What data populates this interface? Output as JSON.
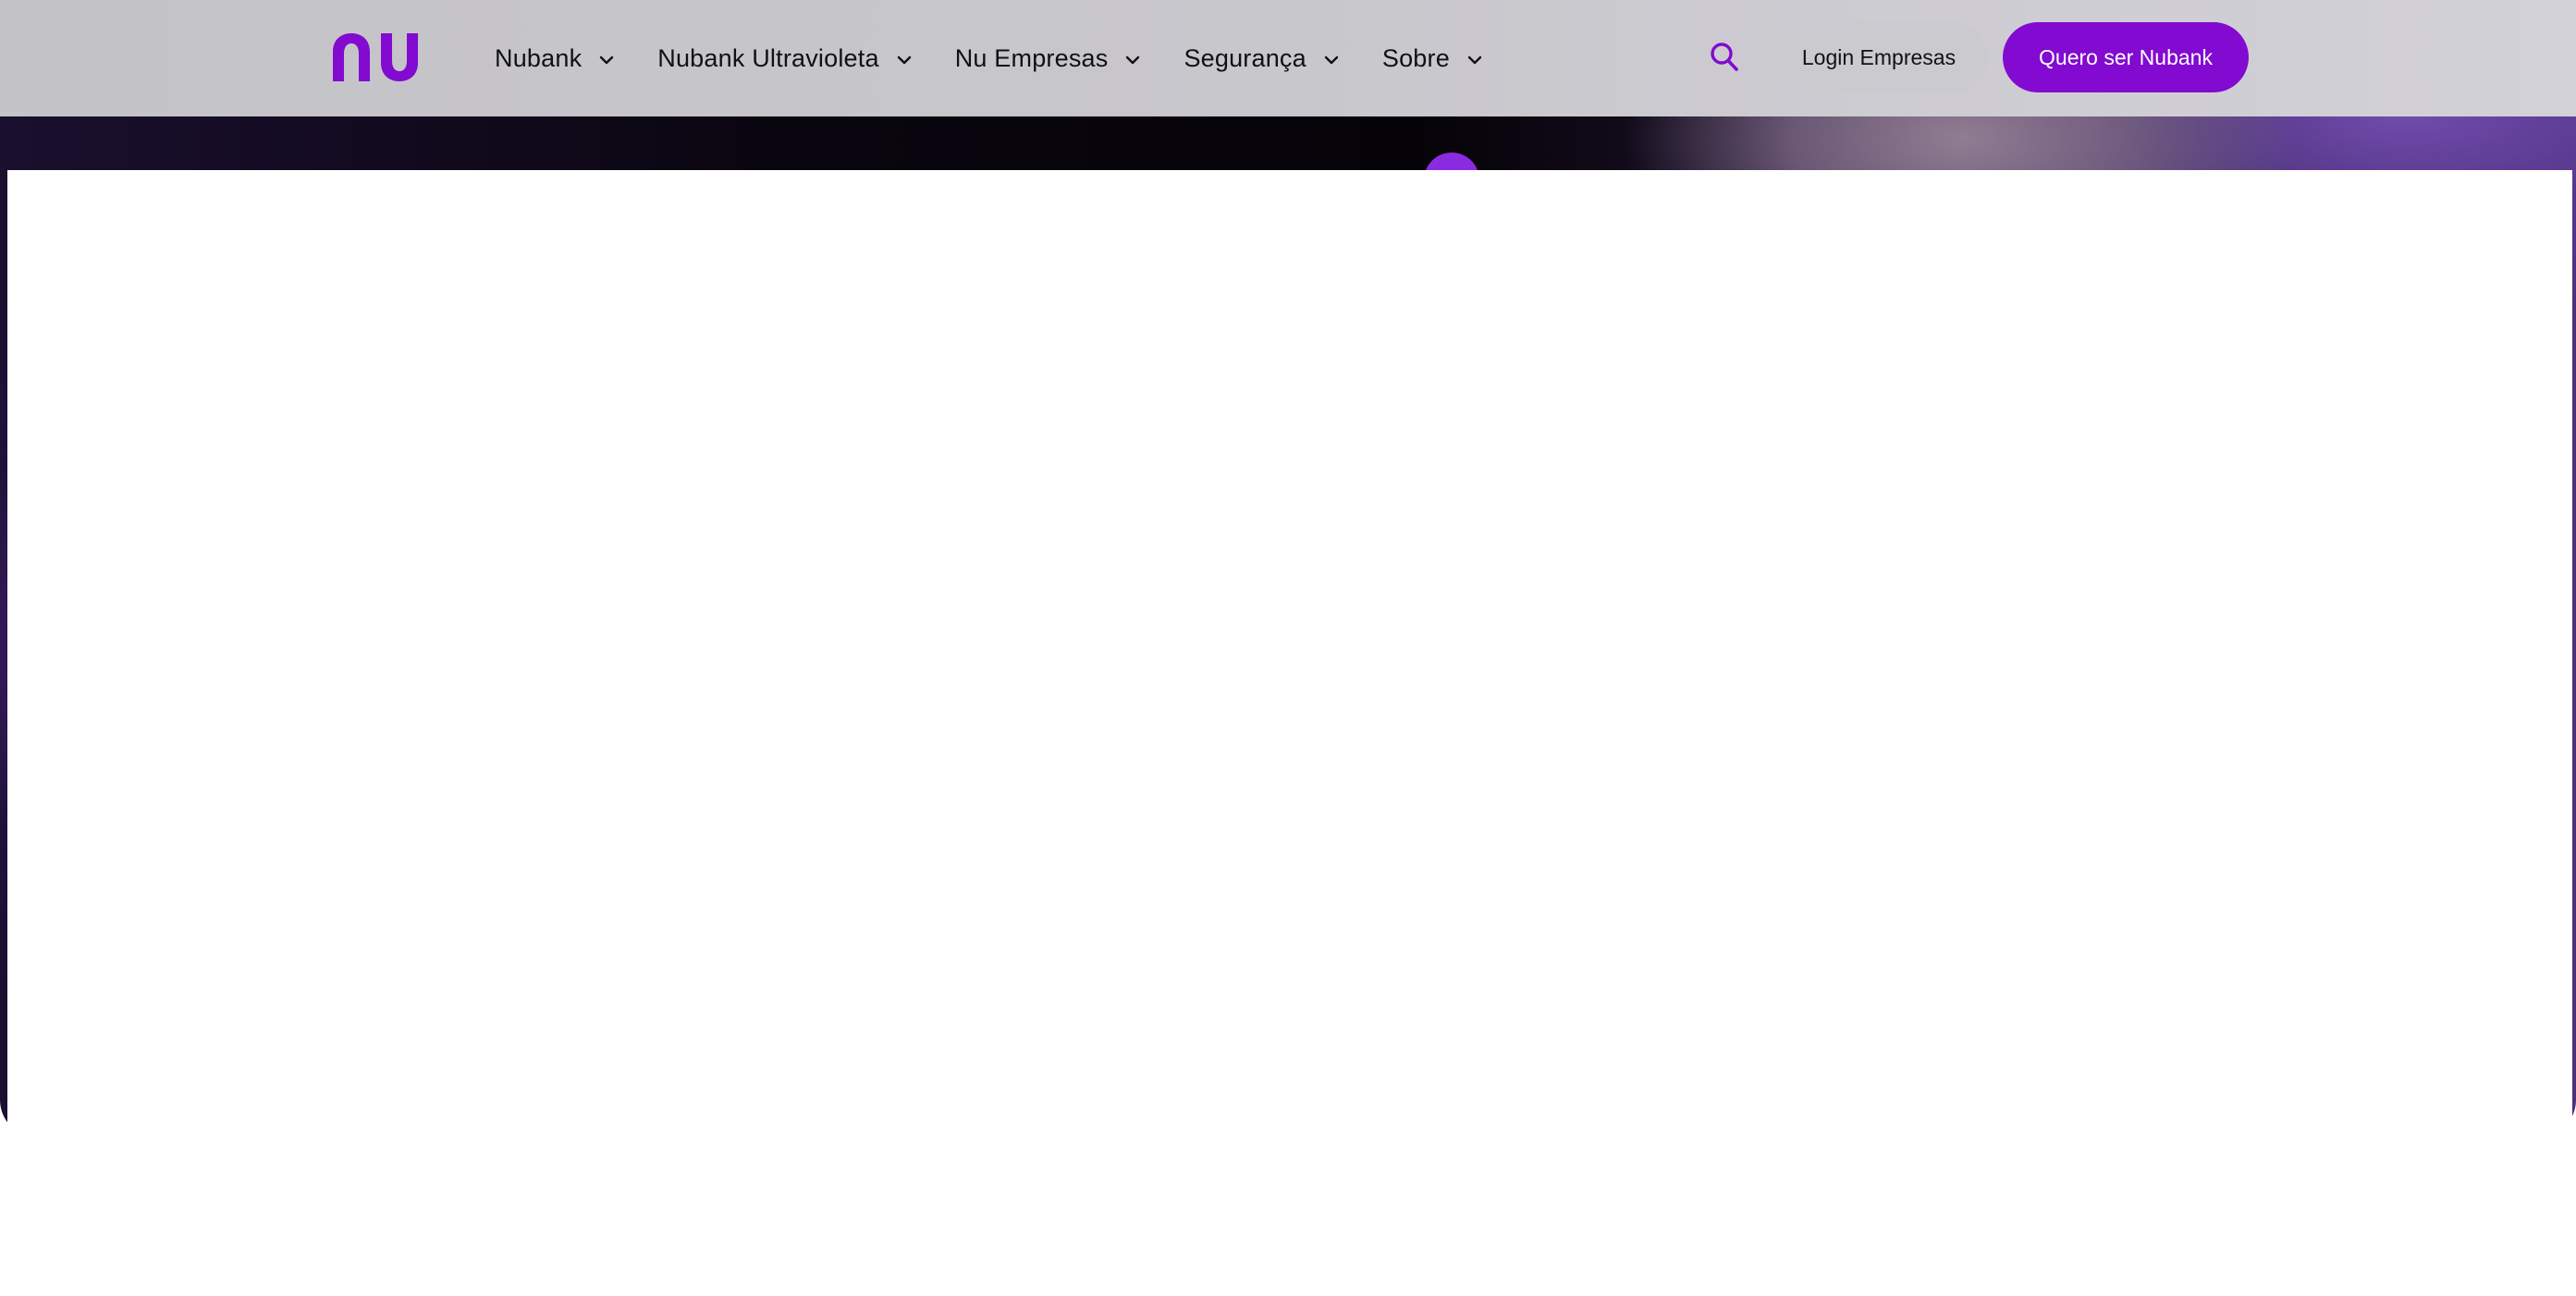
{
  "colors": {
    "brand_purple": "#820ad1",
    "header_bg": "#c8c7cc",
    "nav_text": "#111111",
    "button_text_light": "#ffffff"
  },
  "header": {
    "logo_icon": "nu-logo",
    "nav": [
      {
        "label": "Nubank",
        "icon": "chevron-down-icon"
      },
      {
        "label": "Nubank Ultravioleta",
        "icon": "chevron-down-icon"
      },
      {
        "label": "Nu Empresas",
        "icon": "chevron-down-icon"
      },
      {
        "label": "Segurança",
        "icon": "chevron-down-icon"
      },
      {
        "label": "Sobre",
        "icon": "chevron-down-icon"
      }
    ],
    "search_icon": "search-icon",
    "login_label": "Login Empresas",
    "cta_label": "Quero ser Nubank"
  }
}
